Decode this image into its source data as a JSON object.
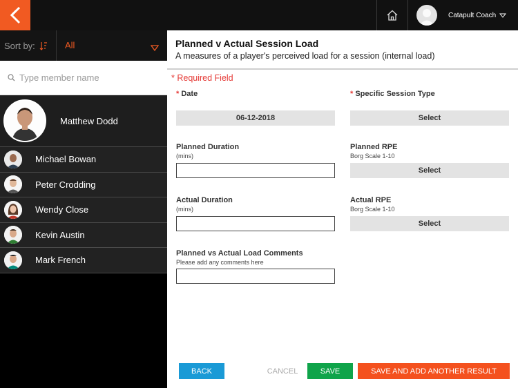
{
  "colors": {
    "brand": "#f15a22",
    "back": "#1a9ad6",
    "save": "#0fa44a",
    "save_add": "#f4511e",
    "required": "#e53935"
  },
  "topbar": {
    "logo_icon": "catapult-logo-icon",
    "home_icon": "home-icon",
    "user_name": "Catapult",
    "user_role": "Coach"
  },
  "sidebar": {
    "sort_label": "Sort by:",
    "filter_value": "All",
    "search_placeholder": "Type member name",
    "selected_member": "Matthew Dodd",
    "members": [
      {
        "name": "Michael Bowan"
      },
      {
        "name": "Peter Crodding"
      },
      {
        "name": "Wendy Close"
      },
      {
        "name": "Kevin Austin"
      },
      {
        "name": "Mark French"
      }
    ]
  },
  "form": {
    "title": "Planned v Actual Session Load",
    "subtitle": "A measures of a player's perceived load for a session (internal load)",
    "required_note": "* Required Field",
    "date": {
      "label": "Date",
      "value": "06-12-2018"
    },
    "session_type": {
      "label": "Specific Session Type",
      "value": "Select"
    },
    "planned_duration": {
      "label": "Planned Duration",
      "hint": "(mins)",
      "value": ""
    },
    "planned_rpe": {
      "label": "Planned RPE",
      "hint": "Borg Scale 1-10",
      "value": "Select"
    },
    "actual_duration": {
      "label": "Actual Duration",
      "hint": "(mins)",
      "value": ""
    },
    "actual_rpe": {
      "label": "Actual RPE",
      "hint": "Borg Scale 1-10",
      "value": "Select"
    },
    "comments": {
      "label": "Planned vs Actual Load Comments",
      "hint": "Please add any comments here",
      "value": ""
    }
  },
  "actions": {
    "back": "BACK",
    "cancel": "CANCEL",
    "save": "SAVE",
    "save_add": "SAVE AND ADD ANOTHER RESULT"
  }
}
